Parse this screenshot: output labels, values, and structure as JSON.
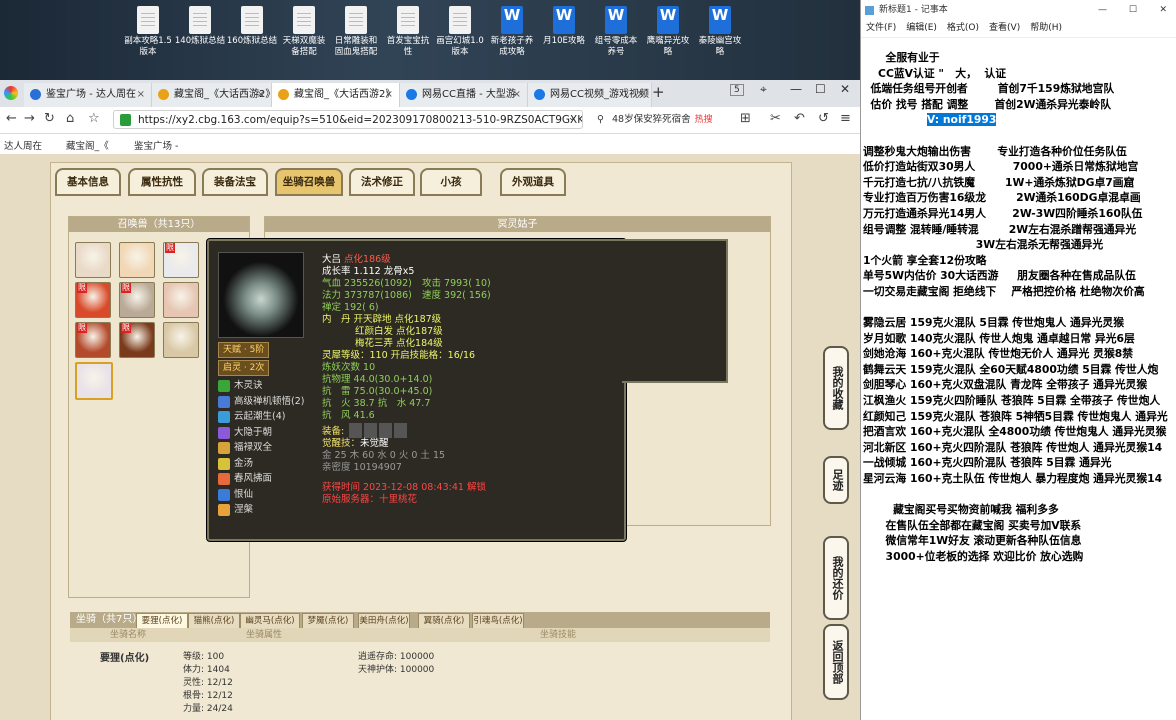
{
  "desktop_icons": [
    {
      "label": "副本攻略1.5\n版本",
      "type": "doc"
    },
    {
      "label": "140炼狱总结",
      "type": "doc"
    },
    {
      "label": "160炼狱总结",
      "type": "doc"
    },
    {
      "label": "天梯双魔装\n备搭配",
      "type": "doc"
    },
    {
      "label": "日常雕装和\n固血鬼搭配",
      "type": "doc"
    },
    {
      "label": "首发宝宝抗\n性",
      "type": "doc"
    },
    {
      "label": "画宫幻城1.0\n版本",
      "type": "doc"
    },
    {
      "label": "新老孩子养\n成攻略",
      "type": "word"
    },
    {
      "label": "月10E攻略",
      "type": "word"
    },
    {
      "label": "组号零成本\n养号",
      "type": "word"
    },
    {
      "label": "鹰嘴异光攻\n略",
      "type": "word"
    },
    {
      "label": "秦陵幽宫攻\n略",
      "type": "word"
    }
  ],
  "browser": {
    "tabs": [
      {
        "label": "鉴宝广场 - 达人周在",
        "active": false,
        "icon_color": "#2a6fd6"
      },
      {
        "label": "藏宝阁_《大话西游2》",
        "active": false,
        "icon_color": "#e8a21a"
      },
      {
        "label": "藏宝阁_《大话西游2》",
        "active": true,
        "icon_color": "#e8a21a"
      },
      {
        "label": "网易CC直播 - 大型游",
        "active": false,
        "icon_color": "#1a78e8"
      },
      {
        "label": "网易CC视频_游戏视频",
        "active": false,
        "icon_color": "#1a78e8"
      }
    ],
    "tab_count": "5",
    "url": "https://xy2.cbg.163.com/equip?s=510&eid=202309170800213-510-9RZS0ACT9GXK&c",
    "search_text": "48岁保安猝死宿舍",
    "search_tag": "热搜",
    "bookmarks": [
      "达人周在",
      "藏宝阁_《",
      "鉴宝广场 -"
    ]
  },
  "game": {
    "tabs": [
      "基本信息",
      "属性抗性",
      "装备法宝",
      "坐骑召唤兽",
      "法术修正",
      "小孩",
      "外观道具"
    ],
    "selected_tab": "坐骑召唤兽",
    "summon_panel_title": "召唤兽（共13只）",
    "detail_panel_title": "冥灵姑子",
    "pet_colors": [
      "#e9d9c7",
      "#f1d7b5",
      "#eae9ec",
      "#d94a2a",
      "#b9a997",
      "#e6c5b2",
      "#b44a2c",
      "#7a3b1c",
      "#d9c8a6",
      "#e9e2e9"
    ],
    "pet_limited": [
      false,
      false,
      true,
      true,
      true,
      false,
      true,
      true,
      false,
      false
    ],
    "mount_label": "坐骑（共7只）",
    "mount_tabs": [
      "要狸(点化)",
      "猫熊(点化)",
      "幽灵马(点化)",
      "梦魇(点化)",
      "美田舟(点化)",
      "翼骑(点化)",
      "引魂鸟(点化)"
    ],
    "mount_cols": [
      "坐骑名称",
      "坐骑属性",
      "坐骑技能"
    ],
    "mount_name": "要狸(点化)",
    "mount_attrs": [
      "等级: 100",
      "体力: 1404",
      "灵性: 12/12",
      "根骨: 12/12",
      "力量: 24/24"
    ],
    "mount_skills": [
      "逍遥存命: 100000",
      "天神护体: 100000"
    ],
    "side_buttons": [
      "我的收藏",
      "足迹",
      "我的还价",
      "返回顶部"
    ]
  },
  "tooltip": {
    "name": "大吕",
    "name_suffix": "点化186级",
    "growth": "成长率 1.112  龙骨x5",
    "hp": "气血 235526(1092)",
    "atk": "攻击 7993( 10)",
    "mp": "法力 373787(1086)",
    "spd": "速度 392( 156)",
    "bond": "禅定 192( 6)",
    "inner": "内　丹 开天辟地 点化187级",
    "inner2": "红颜白发 点化187级",
    "inner3": "梅花三弄 点化184级",
    "spirit": "灵犀等级：110  开启技能格：16/16",
    "lianshou": "炼妖次数 10",
    "res1": "抗物理 44.0(30.0+14.0)",
    "res2": "抗　雷 75.0(30.0+45.0)",
    "res3": "抗　火 38.7   抗　水 47.7",
    "res4": "抗　风 41.6",
    "equip_label": "装备:",
    "awake": "觉醒技：",
    "awake_val": "未觉醒",
    "elements": "金 25  木 60  水 0  火 0  土 15",
    "affinity": "亲密度 10194907",
    "summon_time": "获得时间 2023-12-08 08:43:41",
    "summon_time_tag": "解锁",
    "source_server": "原始服务器：十里桃花",
    "badges": [
      "天赋 · 5阶",
      "启灵 · 2次"
    ],
    "skills": [
      {
        "label": "木灵诀",
        "color": "#3aa63a"
      },
      {
        "label": "高级禅机顿悟(2)",
        "color": "#4a7ad8"
      },
      {
        "label": "云起潮生(4)",
        "color": "#3a9cd8"
      },
      {
        "label": "大隐于朝",
        "color": "#8a5ad8"
      },
      {
        "label": "福禄双全",
        "color": "#d8a23a"
      },
      {
        "label": "金汤",
        "color": "#d8c23a"
      },
      {
        "label": "春风拂面",
        "color": "#e86a3a"
      },
      {
        "label": "恨仙",
        "color": "#3a7ad8"
      },
      {
        "label": "涅槃",
        "color": "#e8a23a"
      }
    ]
  },
  "notepad": {
    "title": "新标题1 - 记事本",
    "menu": [
      "文件(F)",
      "编辑(E)",
      "格式(O)",
      "查看(V)",
      "帮助(H)"
    ],
    "lines": [
      "      全服有业于",
      "    CC蓝V认证 \"   大，  认证",
      "  低端任务组号开创者        首创7千159炼狱地宫队",
      "  估价 找号 搭配 调整       首创2W通杀异光泰岭队",
      "                 V: noif1993",
      "",
      "调整秒鬼大炮输出伤害       专业打造各种价位任务队伍",
      "低价打造站街双30男人          7000+通杀日常炼狱地宫",
      "千元打造七抗/八抗铁魔        1W+通杀炼狱DG卓7画窟",
      "专业打造百万伤害16级龙        2W通杀160DG卓混卓画",
      "万元打造通杀异光14男人       2W-3W四阶睡杀160队伍",
      "组号调整 混转睡/睡转混        2W左右混杀蹭帮强通异光",
      "                              3W左右混杀无帮强通异光",
      "1个火箭 享全套12份攻略",
      "单号5W内估价 30大话西游     朋友圈各种在售成品队伍",
      "一切交易走藏宝阁 拒绝线下    严格把控价格 杜绝物次价高",
      "",
      "雾隐云居 159克火混队 5目霖 传世炮鬼人 通异光灵猴",
      "岁月如歌 140克火混队 传世人炮鬼 通卓越日常 异光6层",
      "剑她沧海 160+克火混队 传世炮无价人 通异光 灵猴8禁",
      "鹤舞云天 159克火混队 全60天赋4800功绩 5目霖 传世人炮",
      "剑胆琴心 160+克火双盘混队 青龙阵 全带孩子 通异光灵猴",
      "江枫渔火 159克火四阶睡队 苍狼阵 5目霖 全带孩子 传世炮人",
      "红颜知己 159克火混队 苍狼阵 5神牺5目霖 传世炮鬼人 通异光",
      "把酒言欢 160+克火混队 全4800功绩 传世炮鬼人 通异光灵猴",
      "河北新区 160+克火四阶混队 苍狼阵 传世炮人 通异光灵猴14",
      "一战倾城 160+克火四阶混队 苍狼阵 5目霖 通异光",
      "星河云海 160+克土队伍 传世炮人 暴力程度炮 通异光灵猴14",
      "",
      "        藏宝阁买号买物资前喊我 福利多多",
      "      在售队伍全部都在藏宝阁 买卖号加V联系",
      "      微信常年1W好友 滚动更新各种队伍信息",
      "      3000+位老板的选择 欢迎比价 放心选购"
    ],
    "highlight": "V: noif1993"
  }
}
